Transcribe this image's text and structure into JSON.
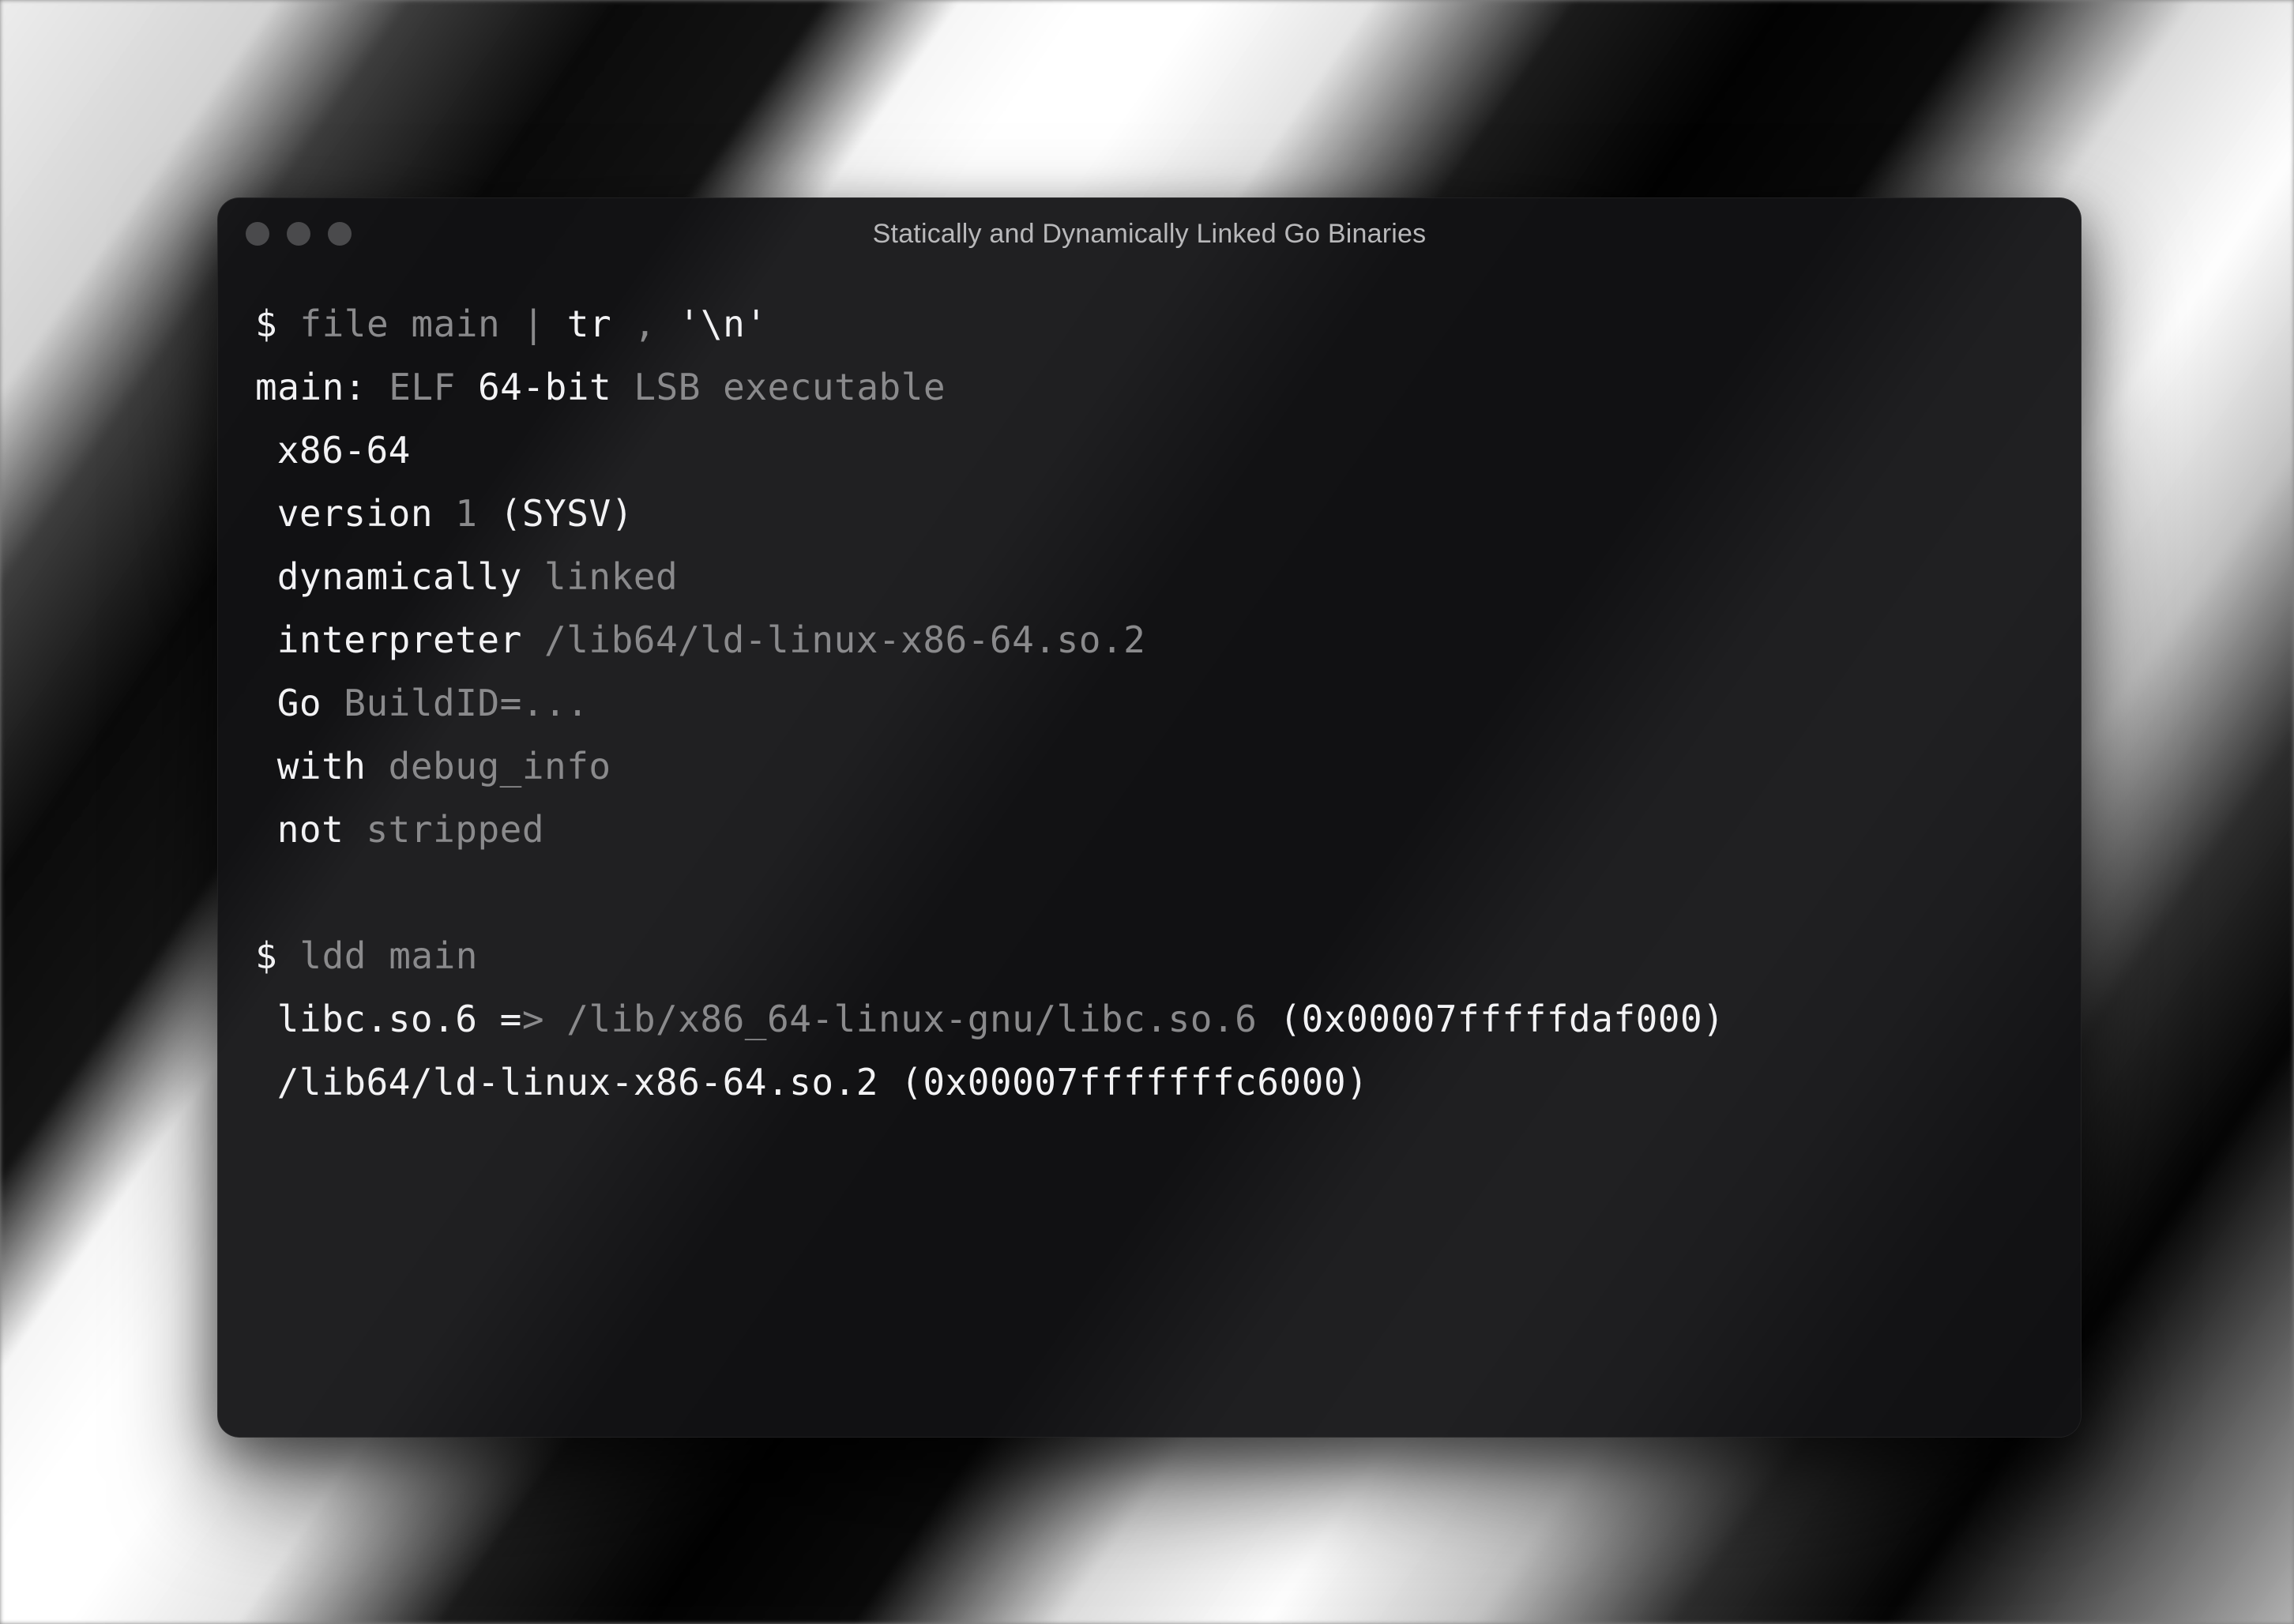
{
  "window": {
    "title": "Statically and Dynamically Linked Go Binaries"
  },
  "terminal": {
    "prompt": "$",
    "cmd1": {
      "p1": "file",
      "p2": "main",
      "pipe": "|",
      "p3": "tr",
      "p4": ",",
      "p5": "'\\n'"
    },
    "out1": {
      "l1a": "main:",
      "l1b": "ELF",
      "l1c": "64-bit",
      "l1d": "LSB",
      "l1e": "executable",
      "l2": "x86-64",
      "l3a": "version",
      "l3b": "1",
      "l3c": "(SYSV)",
      "l4a": "dynamically",
      "l4b": "linked",
      "l5a": "interpreter",
      "l5b": "/lib64/ld-linux-x86-64.so.2",
      "l6a": "Go",
      "l6b": "BuildID=...",
      "l7a": "with",
      "l7b": "debug_info",
      "l8a": "not",
      "l8b": "stripped"
    },
    "cmd2": {
      "p1": "ldd",
      "p2": "main"
    },
    "out2": {
      "l1a": "libc.so.6",
      "l1b": "=",
      "l1c": ">",
      "l1d": "/lib/x86_64-linux-gnu/libc.so.6",
      "l1e": "(0x00007fffffdaf000)",
      "l2": "/lib64/ld-linux-x86-64.so.2 (0x00007fffffffc6000)"
    }
  }
}
